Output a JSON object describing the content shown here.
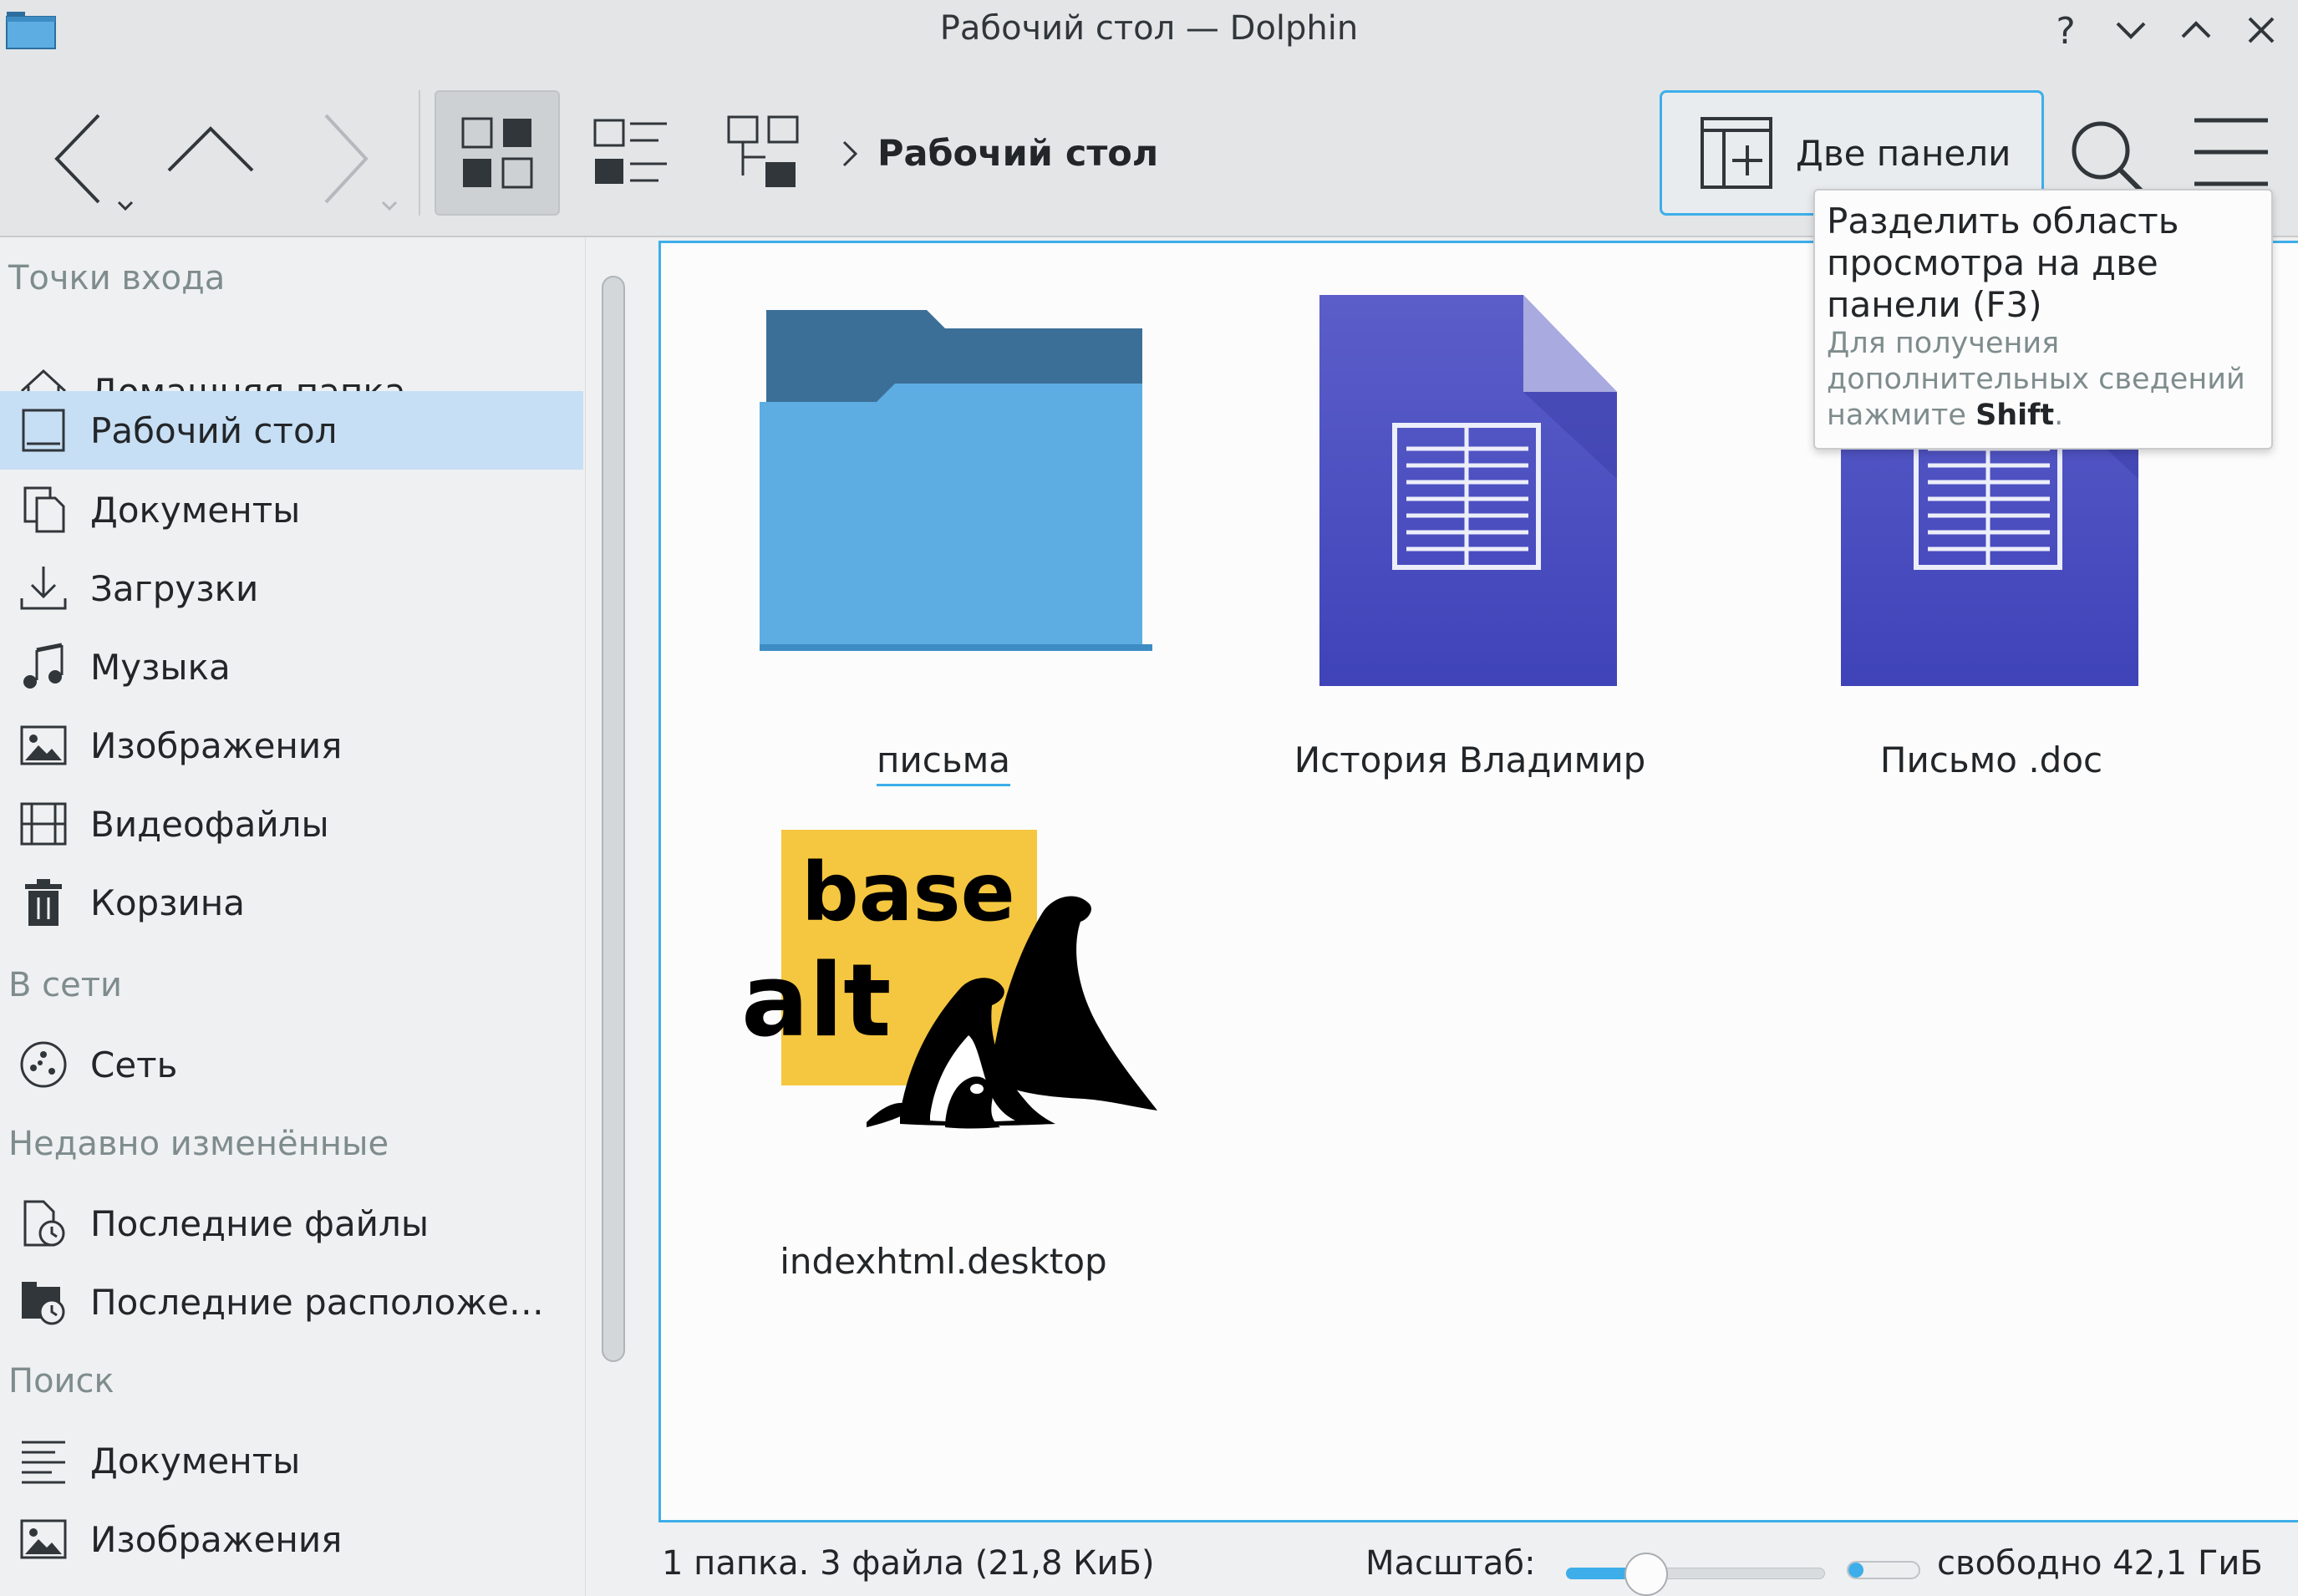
{
  "window": {
    "title": "Рабочий стол — Dolphin",
    "buttons": [
      "help-icon",
      "minimize-icon",
      "maximize-icon",
      "close-icon"
    ]
  },
  "toolbar": {
    "view_modes": [
      "icons",
      "compact",
      "details"
    ],
    "active_view_mode": "icons",
    "breadcrumb": {
      "current": "Рабочий стол"
    },
    "split_label": "Две панели",
    "accent": "#3daee9"
  },
  "tooltip": {
    "title": "Разделить область просмотра на две панели (F3)",
    "hint_prefix": "Для получения дополнительных сведений нажмите ",
    "hint_key": "Shift",
    "hint_suffix": "."
  },
  "sidebar": {
    "sections": [
      {
        "title": "Точки входа",
        "items": [
          {
            "label": "Домашняя папка",
            "icon": "home-icon"
          },
          {
            "label": "Рабочий стол",
            "icon": "desktop-icon",
            "active": true
          },
          {
            "label": "Документы",
            "icon": "documents-icon"
          },
          {
            "label": "Загрузки",
            "icon": "download-icon"
          },
          {
            "label": "Музыка",
            "icon": "music-icon"
          },
          {
            "label": "Изображения",
            "icon": "image-icon"
          },
          {
            "label": "Видеофайлы",
            "icon": "video-icon"
          },
          {
            "label": "Корзина",
            "icon": "trash-icon"
          }
        ]
      },
      {
        "title": "В сети",
        "items": [
          {
            "label": "Сеть",
            "icon": "network-icon"
          }
        ]
      },
      {
        "title": "Недавно изменённые",
        "items": [
          {
            "label": "Последние файлы",
            "icon": "recent-files-icon"
          },
          {
            "label": "Последние расположе…",
            "icon": "recent-locations-icon"
          }
        ]
      },
      {
        "title": "Поиск",
        "items": [
          {
            "label": "Документы",
            "icon": "search-documents-icon"
          },
          {
            "label": "Изображения",
            "icon": "search-images-icon"
          }
        ]
      }
    ]
  },
  "items": [
    {
      "name": "письма",
      "type": "folder",
      "icon": "folder-icon"
    },
    {
      "name": "История Владимир",
      "type": "document",
      "icon": "document-icon"
    },
    {
      "name": "Письмо .doc",
      "type": "document",
      "icon": "document-icon"
    },
    {
      "name": "indexhtml.desktop",
      "type": "desktop",
      "icon": "basealt-logo-icon",
      "logo_text": "base alt"
    }
  ],
  "statusbar": {
    "summary": "1 папка. 3 файла (21,8 КиБ)",
    "zoom_label": "Масштаб:",
    "zoom_fraction": 0.31,
    "space_used_fraction": 0.22,
    "free_space": "свободно 42,1 ГиБ"
  }
}
